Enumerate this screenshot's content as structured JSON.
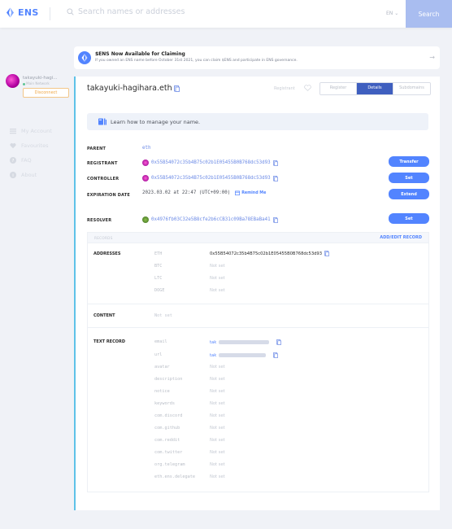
{
  "topbar": {
    "logo_text": "ENS",
    "search_placeholder": "Search names or addresses",
    "language": "EN",
    "search_button": "Search"
  },
  "sidebar": {
    "account_name": "takayuki-hagi...",
    "network": "Main Network",
    "disconnect_label": "Disconnect",
    "nav": [
      {
        "label": "My Account",
        "icon": "list-icon"
      },
      {
        "label": "Favourites",
        "icon": "heart-icon"
      },
      {
        "label": "FAQ",
        "icon": "question-icon"
      },
      {
        "label": "About",
        "icon": "info-icon"
      }
    ]
  },
  "banner": {
    "title": "$ENS Now Available for Claiming",
    "subtitle": "If you owned an ENS name before October 31st 2021, you can claim $ENS and participate in ENS governance."
  },
  "name_card": {
    "name": "takayuki-hagihara.eth",
    "registrant_tab_label": "Registrant",
    "tabs": [
      "Register",
      "Details",
      "Subdomains"
    ],
    "active_tab": "Details",
    "learn_text": "Learn how to manage your name.",
    "parent_label": "PARENT",
    "parent_value": "eth",
    "registrant_label": "REGISTRANT",
    "registrant_value": "0x55B54072c35b4B75c02b1E05455B0B768dc53d93",
    "transfer_label": "Transfer",
    "controller_label": "CONTROLLER",
    "controller_value": "0x55B54072c35b4B75c02b1E05455B0B768dc53d93",
    "set_label": "Set",
    "expiration_label": "EXPIRATION DATE",
    "expiration_value": "2023.03.02 at 22:47 (UTC+09:00)",
    "remind_label": "Remind Me",
    "extend_label": "Extend",
    "resolver_label": "RESOLVER",
    "resolver_value": "0x4976fb03C32e5B8cfe2b6cCB31c09Ba78EBaBa41",
    "resolver_set_label": "Set"
  },
  "records": {
    "header_left": "RECORDS",
    "header_right": "ADD/EDIT RECORD",
    "addresses_label": "ADDRESSES",
    "addresses": [
      {
        "key": "ETH",
        "value": "0x55B54072c35b4B75c02b1E05455B0B768dc53d93"
      },
      {
        "key": "BTC",
        "value": "Not set"
      },
      {
        "key": "LTC",
        "value": "Not set"
      },
      {
        "key": "DOGE",
        "value": "Not set"
      }
    ],
    "content_label": "CONTENT",
    "content_value": "Not set",
    "text_label": "TEXT RECORD",
    "text_records": [
      {
        "key": "email",
        "value": "tak"
      },
      {
        "key": "url",
        "value": "tak"
      },
      {
        "key": "avatar",
        "value": "Not set"
      },
      {
        "key": "description",
        "value": "Not set"
      },
      {
        "key": "notice",
        "value": "Not set"
      },
      {
        "key": "keywords",
        "value": "Not set"
      },
      {
        "key": "com.discord",
        "value": "Not set"
      },
      {
        "key": "com.github",
        "value": "Not set"
      },
      {
        "key": "com.reddit",
        "value": "Not set"
      },
      {
        "key": "com.twitter",
        "value": "Not set"
      },
      {
        "key": "org.telegram",
        "value": "Not set"
      },
      {
        "key": "eth.ens.delegate",
        "value": "Not set"
      }
    ]
  },
  "colors": {
    "accent": "#5284ff",
    "active_tab": "#3f5fbf",
    "card_border": "#5ec2e8",
    "warning": "#f0a644"
  }
}
